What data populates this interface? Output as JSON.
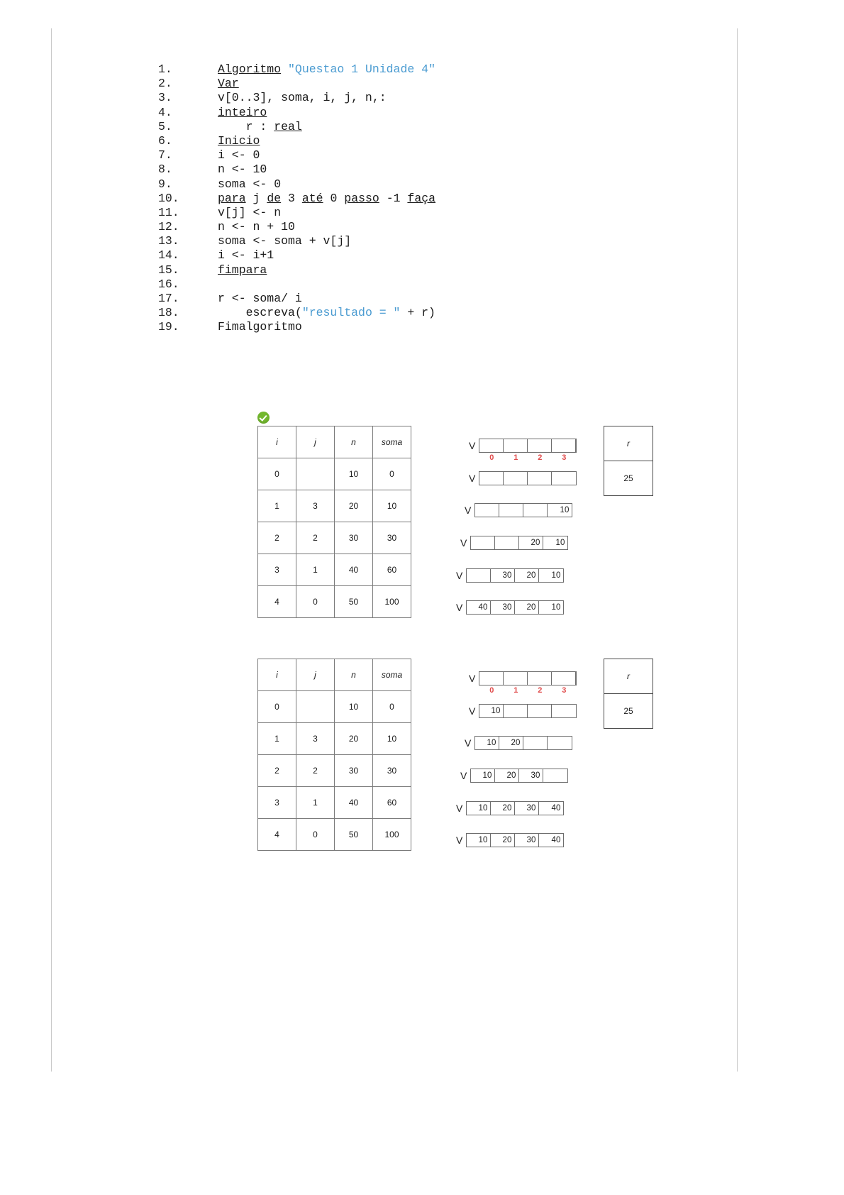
{
  "document": {
    "code": {
      "lines": [
        {
          "num": "1.",
          "indent": 0,
          "tokens": [
            {
              "t": "Algoritmo",
              "s": "kw"
            },
            {
              "t": " ",
              "s": "plain"
            },
            {
              "t": "\"Questao 1 Unidade 4\"",
              "s": "str"
            }
          ]
        },
        {
          "num": "2.",
          "indent": 0,
          "tokens": [
            {
              "t": "Var",
              "s": "kw"
            }
          ]
        },
        {
          "num": "3.",
          "indent": 0,
          "tokens": [
            {
              "t": "v[0..3], soma, i, j, n,:",
              "s": "plain"
            }
          ]
        },
        {
          "num": "4.",
          "indent": 0,
          "tokens": [
            {
              "t": "inteiro",
              "s": "kw"
            }
          ]
        },
        {
          "num": "5.",
          "indent": 0,
          "tokens": [
            {
              "t": "    r : ",
              "s": "plain"
            },
            {
              "t": "real",
              "s": "kw"
            }
          ]
        },
        {
          "num": "6.",
          "indent": 0,
          "tokens": [
            {
              "t": "Inicio",
              "s": "kw"
            }
          ]
        },
        {
          "num": "7.",
          "indent": 0,
          "tokens": [
            {
              "t": "i <- 0",
              "s": "plain"
            }
          ]
        },
        {
          "num": "8.",
          "indent": 0,
          "tokens": [
            {
              "t": "n <- 10",
              "s": "plain"
            }
          ]
        },
        {
          "num": "9.",
          "indent": 0,
          "tokens": [
            {
              "t": "soma <- 0",
              "s": "plain"
            }
          ]
        },
        {
          "num": "10.",
          "indent": 0,
          "tokens": [
            {
              "t": "para",
              "s": "kw"
            },
            {
              "t": " j ",
              "s": "plain"
            },
            {
              "t": "de",
              "s": "kw"
            },
            {
              "t": " 3 ",
              "s": "plain"
            },
            {
              "t": "até",
              "s": "kw"
            },
            {
              "t": " 0 ",
              "s": "plain"
            },
            {
              "t": "passo",
              "s": "kw"
            },
            {
              "t": " -1 ",
              "s": "plain"
            },
            {
              "t": "faça",
              "s": "kw"
            }
          ]
        },
        {
          "num": "11.",
          "indent": 0,
          "tokens": [
            {
              "t": "v[j] <- n",
              "s": "plain"
            }
          ]
        },
        {
          "num": "12.",
          "indent": 0,
          "tokens": [
            {
              "t": "n <- n + 10",
              "s": "plain"
            }
          ]
        },
        {
          "num": "13.",
          "indent": 0,
          "tokens": [
            {
              "t": "soma <- soma + v[j]",
              "s": "plain"
            }
          ]
        },
        {
          "num": "14.",
          "indent": 0,
          "tokens": [
            {
              "t": "i <- i+1",
              "s": "plain"
            }
          ]
        },
        {
          "num": "15.",
          "indent": 0,
          "tokens": [
            {
              "t": "fimpara",
              "s": "kw"
            }
          ]
        },
        {
          "num": "16.",
          "indent": 0,
          "tokens": [
            {
              "t": "",
              "s": "plain"
            }
          ]
        },
        {
          "num": "17.",
          "indent": 0,
          "tokens": [
            {
              "t": "r <- soma/ i",
              "s": "plain"
            }
          ]
        },
        {
          "num": "18.",
          "indent": 0,
          "tokens": [
            {
              "t": "    escreva(",
              "s": "plain"
            },
            {
              "t": "\"resultado = \"",
              "s": "str"
            },
            {
              "t": " + r)",
              "s": "plain"
            }
          ]
        },
        {
          "num": "19.",
          "indent": 0,
          "tokens": [
            {
              "t": "Fimalgoritmo",
              "s": "plain"
            }
          ]
        }
      ]
    },
    "blocks": [
      {
        "id": "trace-block-1",
        "has_check_icon": true,
        "table": {
          "headers": [
            "i",
            "j",
            "n",
            "soma"
          ],
          "rows": [
            [
              "0",
              "",
              "10",
              "0"
            ],
            [
              "1",
              "3",
              "20",
              "10"
            ],
            [
              "2",
              "2",
              "30",
              "30"
            ],
            [
              "3",
              "1",
              "40",
              "60"
            ],
            [
              "4",
              "0",
              "50",
              "100"
            ]
          ]
        },
        "arrays": {
          "label": "V",
          "indices": [
            "0",
            "1",
            "2",
            "3"
          ],
          "rows": [
            {
              "cells": [
                "",
                "",
                "",
                ""
              ],
              "show_indices": true
            },
            {
              "cells": [
                "",
                "",
                "",
                ""
              ],
              "show_indices": false
            },
            {
              "cells": [
                "",
                "",
                "",
                "10"
              ],
              "show_indices": false
            },
            {
              "cells": [
                "",
                "",
                "20",
                "10"
              ],
              "show_indices": false
            },
            {
              "cells": [
                "",
                "30",
                "20",
                "10"
              ],
              "show_indices": false
            },
            {
              "cells": [
                "40",
                "30",
                "20",
                "10"
              ],
              "show_indices": false
            }
          ]
        },
        "result": {
          "header": "r",
          "value": "25"
        }
      },
      {
        "id": "trace-block-2",
        "has_check_icon": false,
        "table": {
          "headers": [
            "i",
            "j",
            "n",
            "soma"
          ],
          "rows": [
            [
              "0",
              "",
              "10",
              "0"
            ],
            [
              "1",
              "3",
              "20",
              "10"
            ],
            [
              "2",
              "2",
              "30",
              "30"
            ],
            [
              "3",
              "1",
              "40",
              "60"
            ],
            [
              "4",
              "0",
              "50",
              "100"
            ]
          ]
        },
        "arrays": {
          "label": "V",
          "indices": [
            "0",
            "1",
            "2",
            "3"
          ],
          "rows": [
            {
              "cells": [
                "",
                "",
                "",
                ""
              ],
              "show_indices": true
            },
            {
              "cells": [
                "10",
                "",
                "",
                ""
              ],
              "show_indices": false
            },
            {
              "cells": [
                "10",
                "20",
                "",
                ""
              ],
              "show_indices": false
            },
            {
              "cells": [
                "10",
                "20",
                "30",
                ""
              ],
              "show_indices": false
            },
            {
              "cells": [
                "10",
                "20",
                "30",
                "40"
              ],
              "show_indices": false
            },
            {
              "cells": [
                "10",
                "20",
                "30",
                "40"
              ],
              "show_indices": false
            }
          ]
        },
        "result": {
          "header": "r",
          "value": "25"
        }
      }
    ],
    "colors": {
      "keyword": "#1a1a1a",
      "string": "#4a9bd1",
      "index_label": "#e04a4a",
      "check_icon": "#73b82e",
      "table_border": "#7b7b7b"
    }
  }
}
